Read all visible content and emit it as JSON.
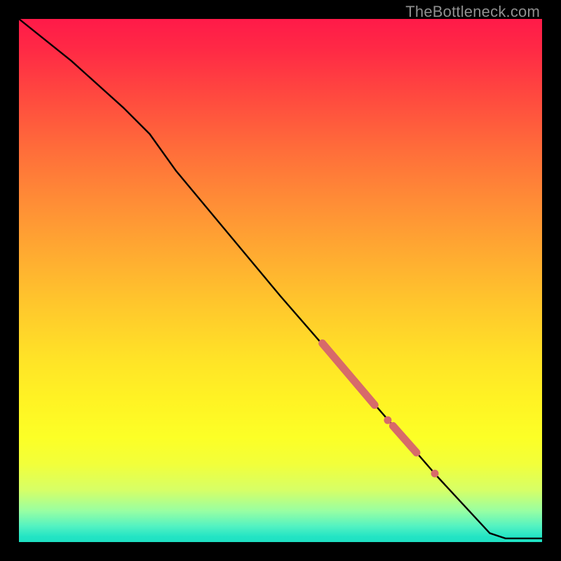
{
  "watermark": "TheBottleneck.com",
  "colors": {
    "line": "#000000",
    "highlight": "#d76a6a",
    "frame": "#000000"
  },
  "chart_data": {
    "type": "line",
    "title": "",
    "xlabel": "",
    "ylabel": "",
    "xlim": [
      0,
      100
    ],
    "ylim": [
      0,
      100
    ],
    "grid": false,
    "series": [
      {
        "name": "curve",
        "x": [
          0,
          10,
          20,
          25,
          30,
          40,
          50,
          60,
          70,
          80,
          90,
          93,
          100
        ],
        "y": [
          100,
          92,
          83,
          78,
          71,
          59,
          47,
          35.5,
          24,
          12.5,
          1.7,
          0.7,
          0.7
        ]
      }
    ],
    "highlights": [
      {
        "name": "thick-segment-1",
        "x0": 58,
        "x1": 68,
        "y0": 38,
        "y1": 26.2
      },
      {
        "name": "dot-1",
        "cx": 70.5,
        "cy": 23.3
      },
      {
        "name": "thick-segment-2",
        "x0": 71.5,
        "x1": 76,
        "y0": 22.2,
        "y1": 17.1
      },
      {
        "name": "dot-2",
        "cx": 79.5,
        "cy": 13.1
      }
    ]
  }
}
